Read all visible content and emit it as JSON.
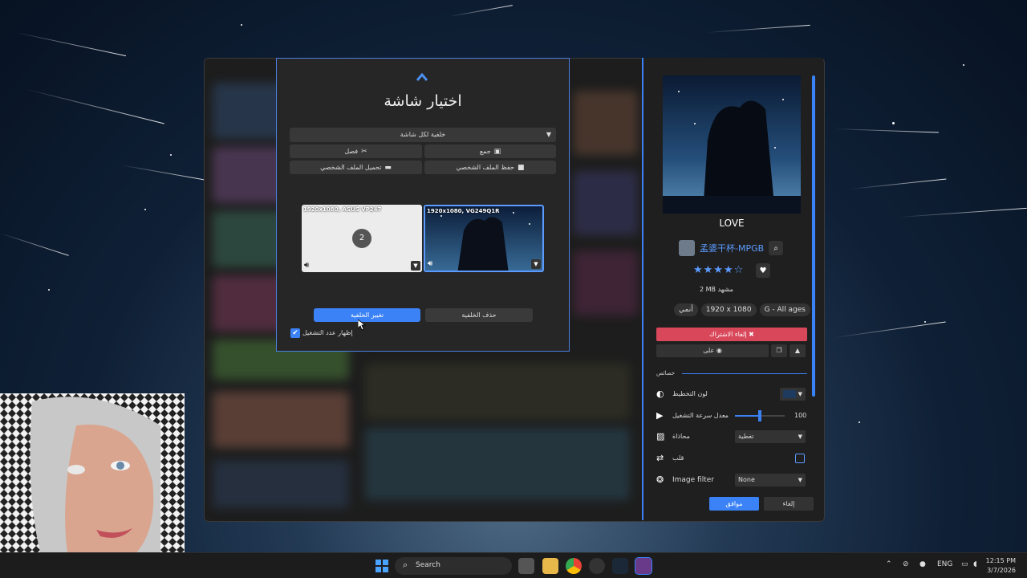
{
  "dialog": {
    "title": "اختيار شاشة",
    "select_value": "خلفية لكل شاشة",
    "split_label": "فصل",
    "merge_label": "جمع",
    "load_profile_label": "تحميل الملف الشخصي",
    "save_profile_label": "حفظ الملف الشخصي",
    "monitors": [
      {
        "label": "1920x1080, ASUS VP247",
        "number": "2"
      },
      {
        "label": "1920x1080, VG249Q1R"
      }
    ],
    "change_wallpaper_label": "تغيير الخلفية",
    "remove_wallpaper_label": "حذف الخلفية",
    "show_count_label": "إظهار عدد التشغيل"
  },
  "panel": {
    "title": "LOVE",
    "author": "孟婆干杯-MPGB",
    "rating_stars": "★★★★☆",
    "rating_value": 4,
    "size": "2 MB مشهد",
    "tags": [
      "أنمي",
      "1920 x 1080",
      "G - All ages"
    ],
    "unsubscribe_label": "إلغاء الاشتراك ✖",
    "on_label": "على",
    "section_label": "خصائص",
    "properties": {
      "scheme_color_label": "لون التخطيط",
      "scheme_color": "#1e3a5f",
      "playback_rate_label": "معدل سرعة التشغيل",
      "playback_rate_value": "100",
      "alignment_label": "محاذاة",
      "alignment_value": "تغطية",
      "flip_label": "قلب",
      "image_filter_label": "Image filter",
      "image_filter_value": "None"
    },
    "ok_label": "موافق",
    "cancel_label": "إلغاء"
  },
  "taskbar": {
    "search_placeholder": "Search",
    "language": "ENG",
    "time": "12:15 PM",
    "date": "3/7/2026"
  },
  "colors": {
    "accent": "#3b82f6",
    "danger": "#d9475a"
  }
}
